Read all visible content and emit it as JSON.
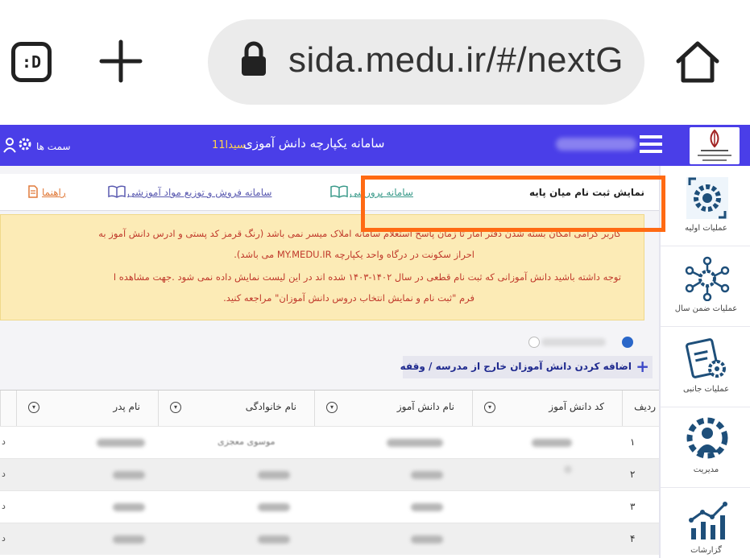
{
  "browser": {
    "tabs_label": ":D",
    "url": "sida.medu.ir/#/nextG"
  },
  "header": {
    "title": "سامانه یکپارچه دانش آموزی",
    "version": "سیدا11",
    "roles_label": "سمت ها",
    "accent": "#4a3ee8"
  },
  "sidebar": {
    "items": [
      {
        "label": "عملیات اولیه",
        "icon": "gear-refresh-icon"
      },
      {
        "label": "عملیات ضمن سال",
        "icon": "network-gear-icon"
      },
      {
        "label": "عملیات جانبی",
        "icon": "clipboard-gear-icon"
      },
      {
        "label": "مدیریت",
        "icon": "manager-gear-icon"
      },
      {
        "label": "گزارشات",
        "icon": "chart-icon"
      }
    ]
  },
  "toolbar": {
    "title": "نمایش ثبت نام میان پایه",
    "link_parvareshi": "سامانه پرورشی",
    "link_foroush": "سامانه فروش و توزیع مواد آموزشی",
    "link_rahnama": "راهنما"
  },
  "alert": {
    "line1": "کاربر گرامی امکان بسته شدن دفتر آمار تا زمان پاسخ استعلام سامانه املاک میسر نمی باشد (رنگ قرمز کد پستی و ادرس دانش آموز به",
    "line2": "احراز سکونت در درگاه واحد یکپارچه  MY.MEDU.IR  می باشد).",
    "line3": "توجه داشته باشید دانش آموزانی که ثبت نام قطعی در سال ۱۴۰۲-۱۴۰۳ شده اند در این لیست نمایش داده نمی شود .جهت مشاهده ا",
    "line4": "فرم \"ثبت نام و نمایش انتخاب دروس دانش آموزان\" مراجعه کنید.",
    "bg": "#fcebb6",
    "text_color": "#c0392b"
  },
  "actions": {
    "add_plus": "+",
    "add_external": "اضافه کردن دانش آموزان خارج از مدرسه / وقفه",
    "highlight": "#ff6a13"
  },
  "table": {
    "headers": {
      "row": "ردیف",
      "code": "کد دانش آموز",
      "name": "نام دانش آموز",
      "family": "نام خانوادگی",
      "father": "نام پدر"
    },
    "rows": [
      {
        "num": "۱"
      },
      {
        "num": "۲"
      },
      {
        "num": "۳"
      },
      {
        "num": "۴"
      }
    ],
    "family_cell_1": "موسوی معجزی",
    "partial_col": "د"
  }
}
